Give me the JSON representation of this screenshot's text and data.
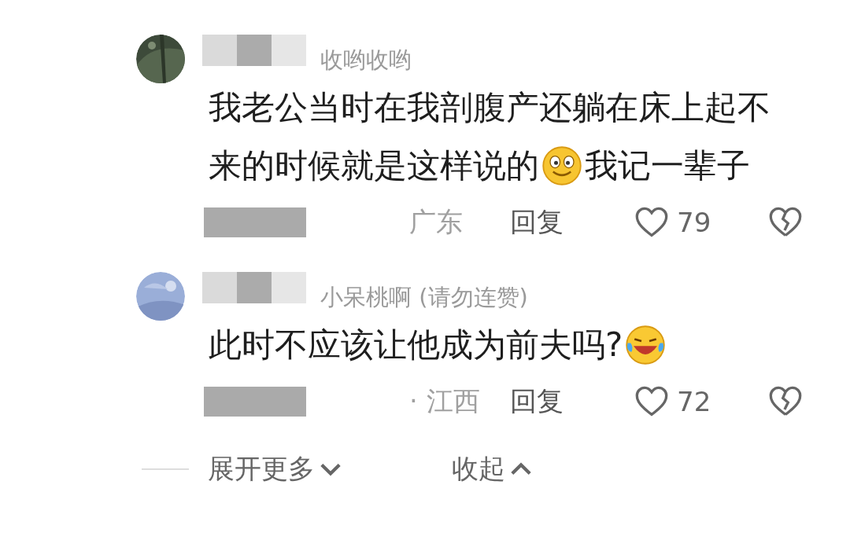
{
  "comments": [
    {
      "username": "收哟收哟",
      "username_redacted": true,
      "date_redacted": true,
      "lines": [
        [
          {
            "kind": "text",
            "text": "我老公当时在我剖腹产还躺在床上起不"
          }
        ],
        [
          {
            "kind": "text",
            "text": "来的时候就是这样说的"
          },
          {
            "kind": "smile_emoji"
          },
          {
            "kind": "text",
            "text": "我记一辈子"
          }
        ]
      ],
      "location": "广东",
      "reply": "回复",
      "likes": "79"
    },
    {
      "username": "小呆桃啊 (请勿连赞)",
      "username_redacted": true,
      "date_redacted": true,
      "lines": [
        [
          {
            "kind": "text",
            "text": "此时不应该让他成为前夫吗?"
          },
          {
            "kind": "laugh_emoji"
          }
        ]
      ],
      "location": "· 江西",
      "reply": "回复",
      "likes": "72"
    }
  ],
  "expand": {
    "label": "展开更多"
  },
  "collapse": {
    "label": "收起"
  }
}
